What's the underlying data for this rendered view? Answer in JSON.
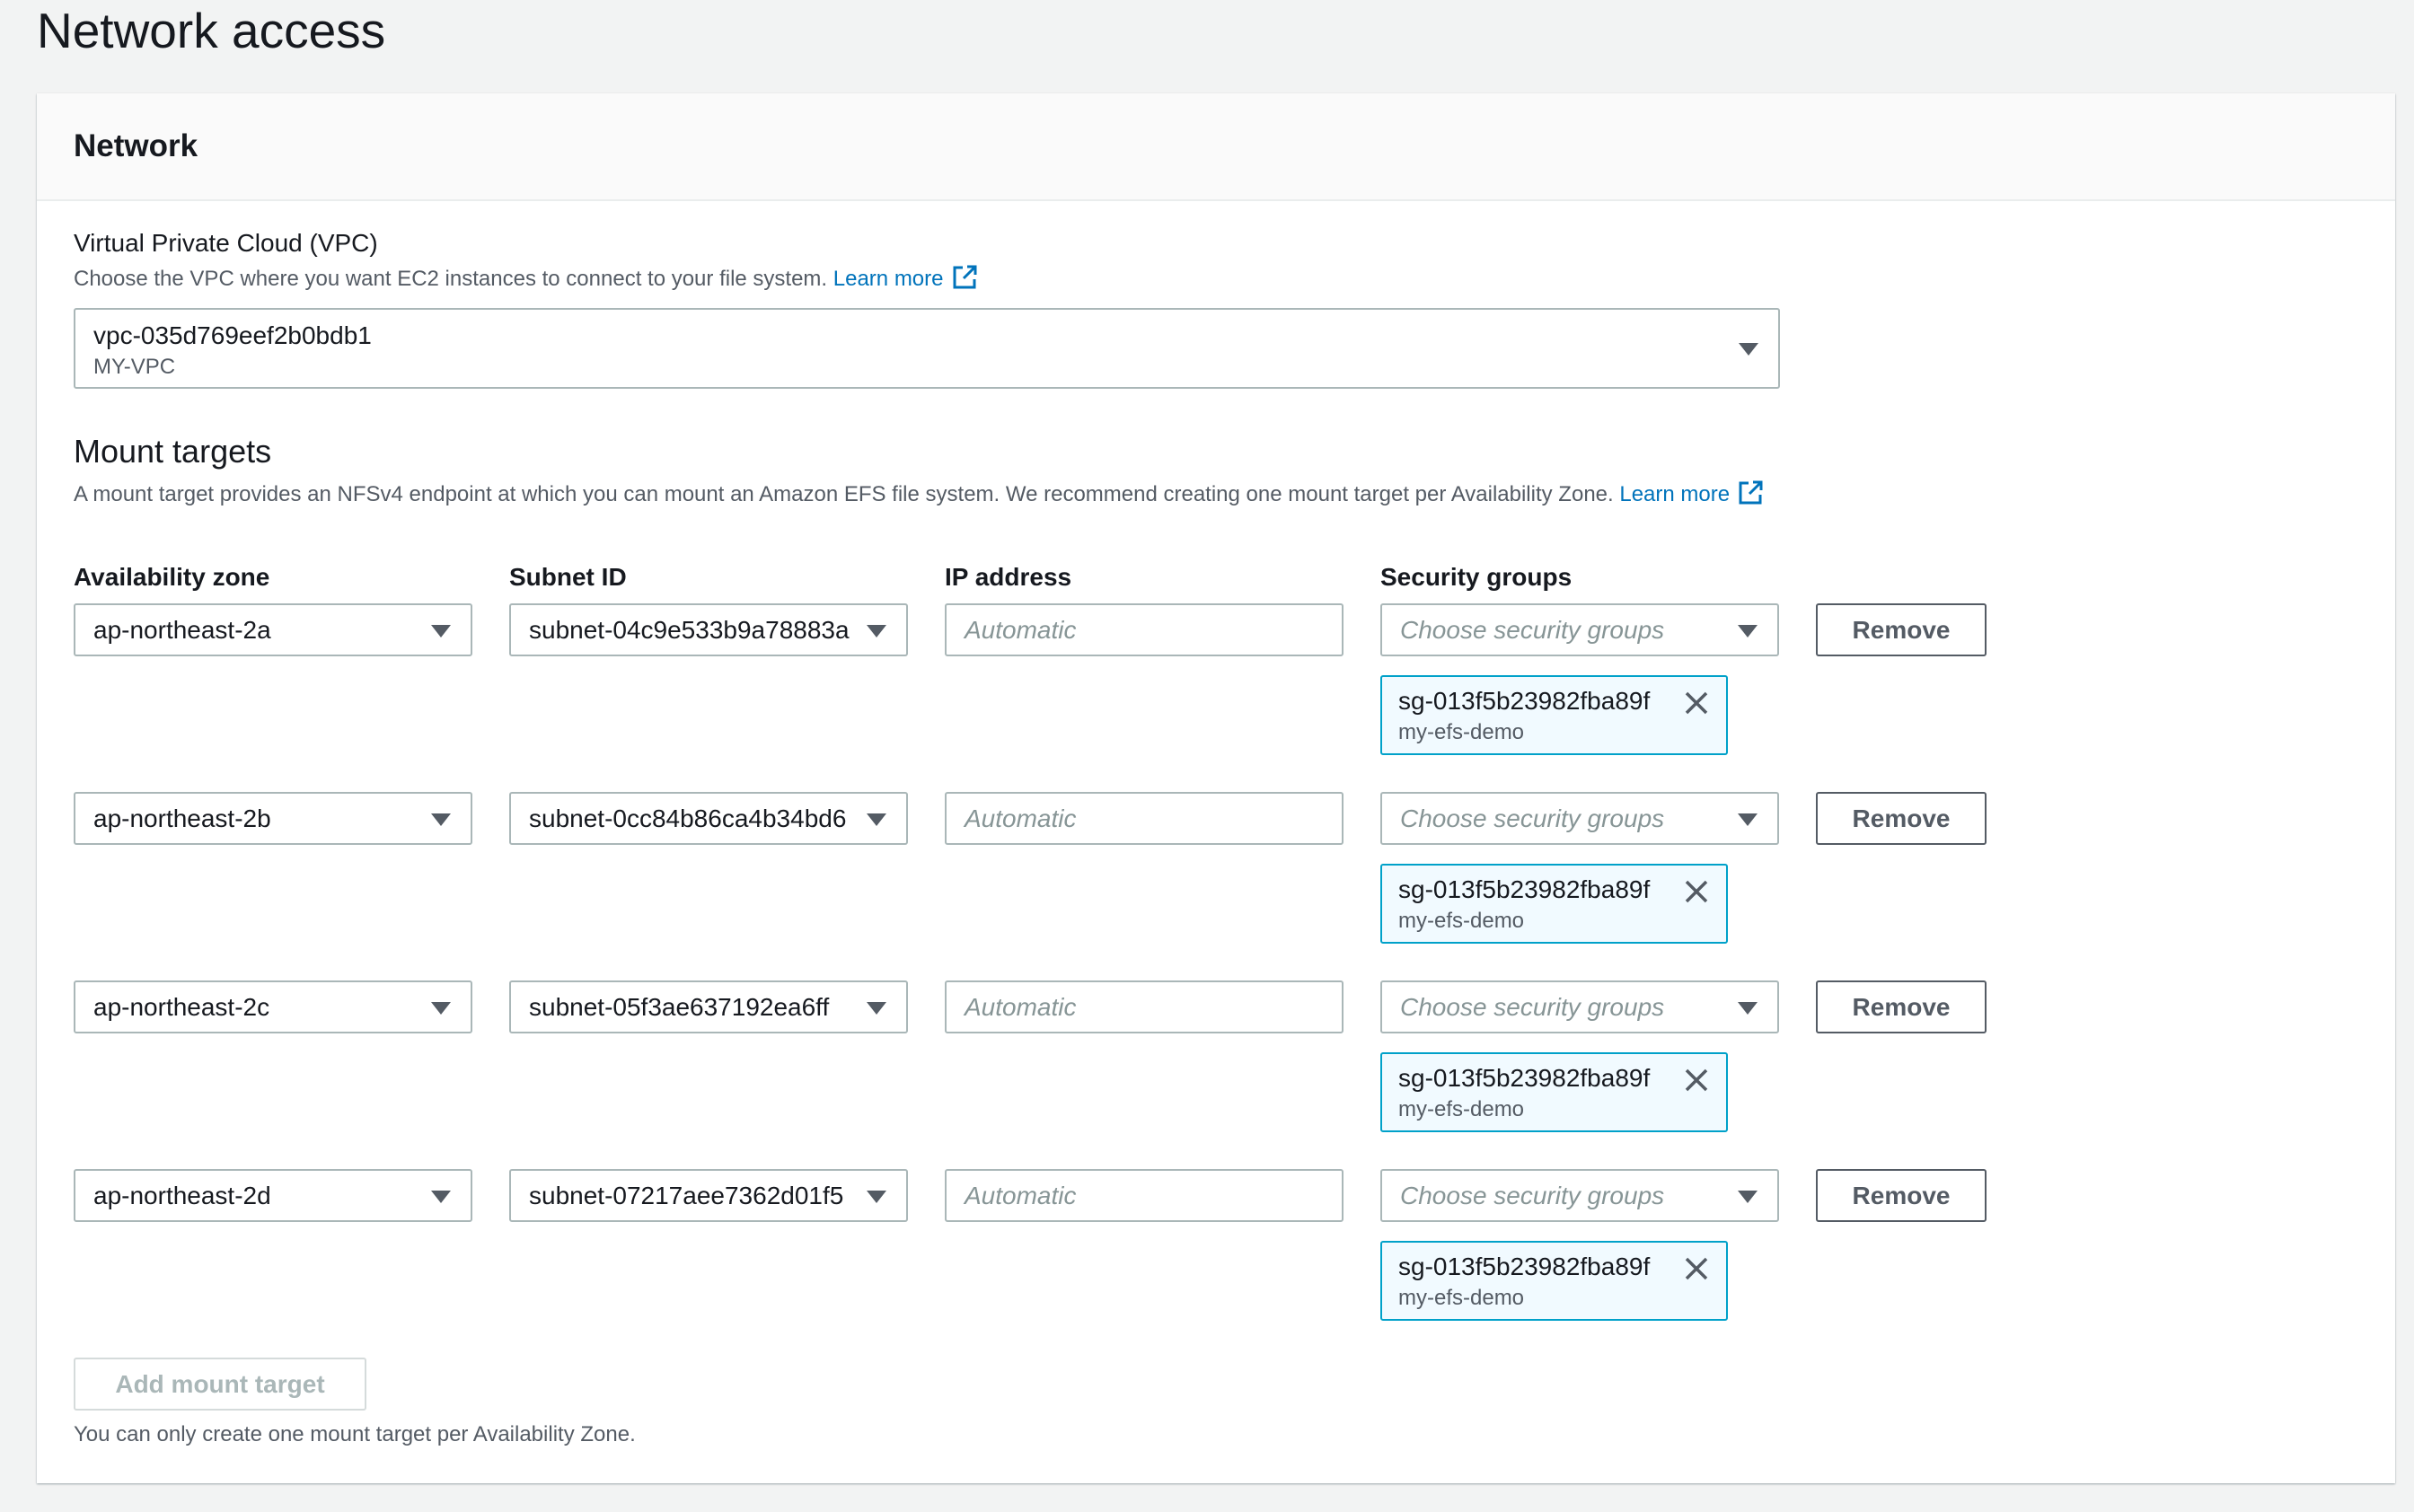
{
  "page": {
    "title": "Network access"
  },
  "network": {
    "title": "Network",
    "vpc": {
      "label": "Virtual Private Cloud (VPC)",
      "description": "Choose the VPC where you want EC2 instances to connect to your file system.",
      "learn_more": "Learn more",
      "selected_id": "vpc-035d769eef2b0bdb1",
      "selected_name": "MY-VPC"
    },
    "mount_targets": {
      "title": "Mount targets",
      "description": "A mount target provides an NFSv4 endpoint at which you can mount an Amazon EFS file system. We recommend creating one mount target per Availability Zone.",
      "learn_more": "Learn more",
      "columns": {
        "availability_zone": "Availability zone",
        "subnet_id": "Subnet ID",
        "ip_address": "IP address",
        "security_groups": "Security groups"
      },
      "ip_placeholder": "Automatic",
      "sg_placeholder": "Choose security groups",
      "remove_label": "Remove",
      "rows": [
        {
          "az": "ap-northeast-2a",
          "subnet": "subnet-04c9e533b9a78883a",
          "sg_id": "sg-013f5b23982fba89f",
          "sg_name": "my-efs-demo"
        },
        {
          "az": "ap-northeast-2b",
          "subnet": "subnet-0cc84b86ca4b34bd6",
          "sg_id": "sg-013f5b23982fba89f",
          "sg_name": "my-efs-demo"
        },
        {
          "az": "ap-northeast-2c",
          "subnet": "subnet-05f3ae637192ea6ff",
          "sg_id": "sg-013f5b23982fba89f",
          "sg_name": "my-efs-demo"
        },
        {
          "az": "ap-northeast-2d",
          "subnet": "subnet-07217aee7362d01f5",
          "sg_id": "sg-013f5b23982fba89f",
          "sg_name": "my-efs-demo"
        }
      ],
      "add_label": "Add mount target",
      "add_hint": "You can only create one mount target per Availability Zone."
    }
  },
  "icons": {
    "external_link": "external-link-icon",
    "dropdown": "caret-down-icon",
    "dismiss": "close-icon"
  },
  "colors": {
    "link": "#0073bb",
    "token_border": "#00a1c9",
    "token_bg": "#f1faff"
  }
}
